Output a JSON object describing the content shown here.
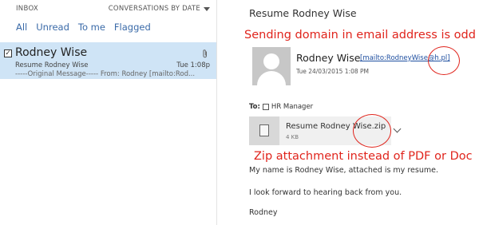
{
  "list": {
    "folder_label": "INBOX",
    "sort_label": "CONVERSATIONS BY DATE",
    "filters": [
      "All",
      "Unread",
      "To me",
      "Flagged"
    ],
    "message": {
      "sender": "Rodney Wise",
      "subject": "Resume Rodney Wise",
      "time": "Tue 1:08p",
      "preview": "-----Original Message----- From: Rodney [mailto:Rod..."
    }
  },
  "reading": {
    "subject": "Resume Rodney Wise",
    "from_name": "Rodney Wise",
    "from_address": "[mailto:RodneyWise@h.pl]",
    "date": "Tue 24/03/2015 1:08 PM",
    "to_label": "To:",
    "to_recipient": "HR Manager",
    "attachment": {
      "name": "Resume Rodney Wise.zip",
      "size": "4 KB"
    },
    "body_lines": [
      "My name is Rodney Wise, attached is my resume.",
      "I look forward to hearing back from you.",
      "Rodney"
    ]
  },
  "annotations": {
    "domain_note": "Sending domain in email address is odd",
    "zip_note": "Zip attachment instead of PDF or Doc",
    "color": "#e0241c"
  },
  "colors": {
    "selected_row": "#cfe4f6",
    "link": "#1f4fa0",
    "filter_text": "#3a6aa8"
  }
}
